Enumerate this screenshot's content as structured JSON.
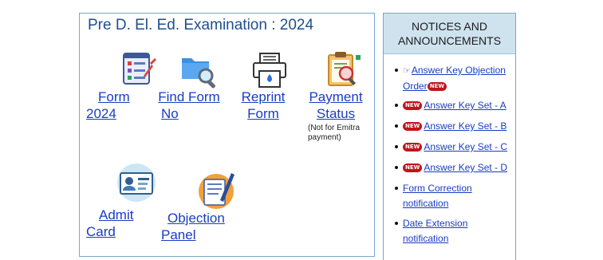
{
  "main": {
    "title": "Pre D. El. Ed. Examination : 2024",
    "tiles": [
      {
        "line1": "Form",
        "line2": "2024",
        "icon": "form-checklist-icon"
      },
      {
        "line1": "Find Form",
        "line2": "No",
        "icon": "folder-search-icon"
      },
      {
        "line1": "Reprint",
        "line2": "Form",
        "icon": "printer-icon"
      },
      {
        "line1": "Payment",
        "line2": "Status",
        "note": "(Not for Emitra payment)",
        "icon": "clipboard-search-icon"
      },
      {
        "line1": "Admit",
        "line2": "Card",
        "icon": "id-card-icon"
      },
      {
        "line1": "Objection",
        "line2": "Panel",
        "icon": "document-pen-icon"
      }
    ]
  },
  "notices": {
    "header_line1": "NOTICES AND",
    "header_line2": "ANNOUNCEMENTS",
    "new_badge": "NEW",
    "items": [
      {
        "text": "Answer Key Objection Order"
      },
      {
        "text": "Answer Key Set - A"
      },
      {
        "text": "Answer Key Set - B"
      },
      {
        "text": "Answer Key Set - C"
      },
      {
        "text": "Answer Key Set - D"
      },
      {
        "text": "Form Correction notification"
      },
      {
        "text": "Date Extension notification"
      }
    ]
  },
  "colors": {
    "link": "#1a3cc4",
    "title": "#1f4e8f",
    "header_bg": "#cfe3ef",
    "border": "#7aa6c8",
    "new_badge": "#c0141c"
  }
}
